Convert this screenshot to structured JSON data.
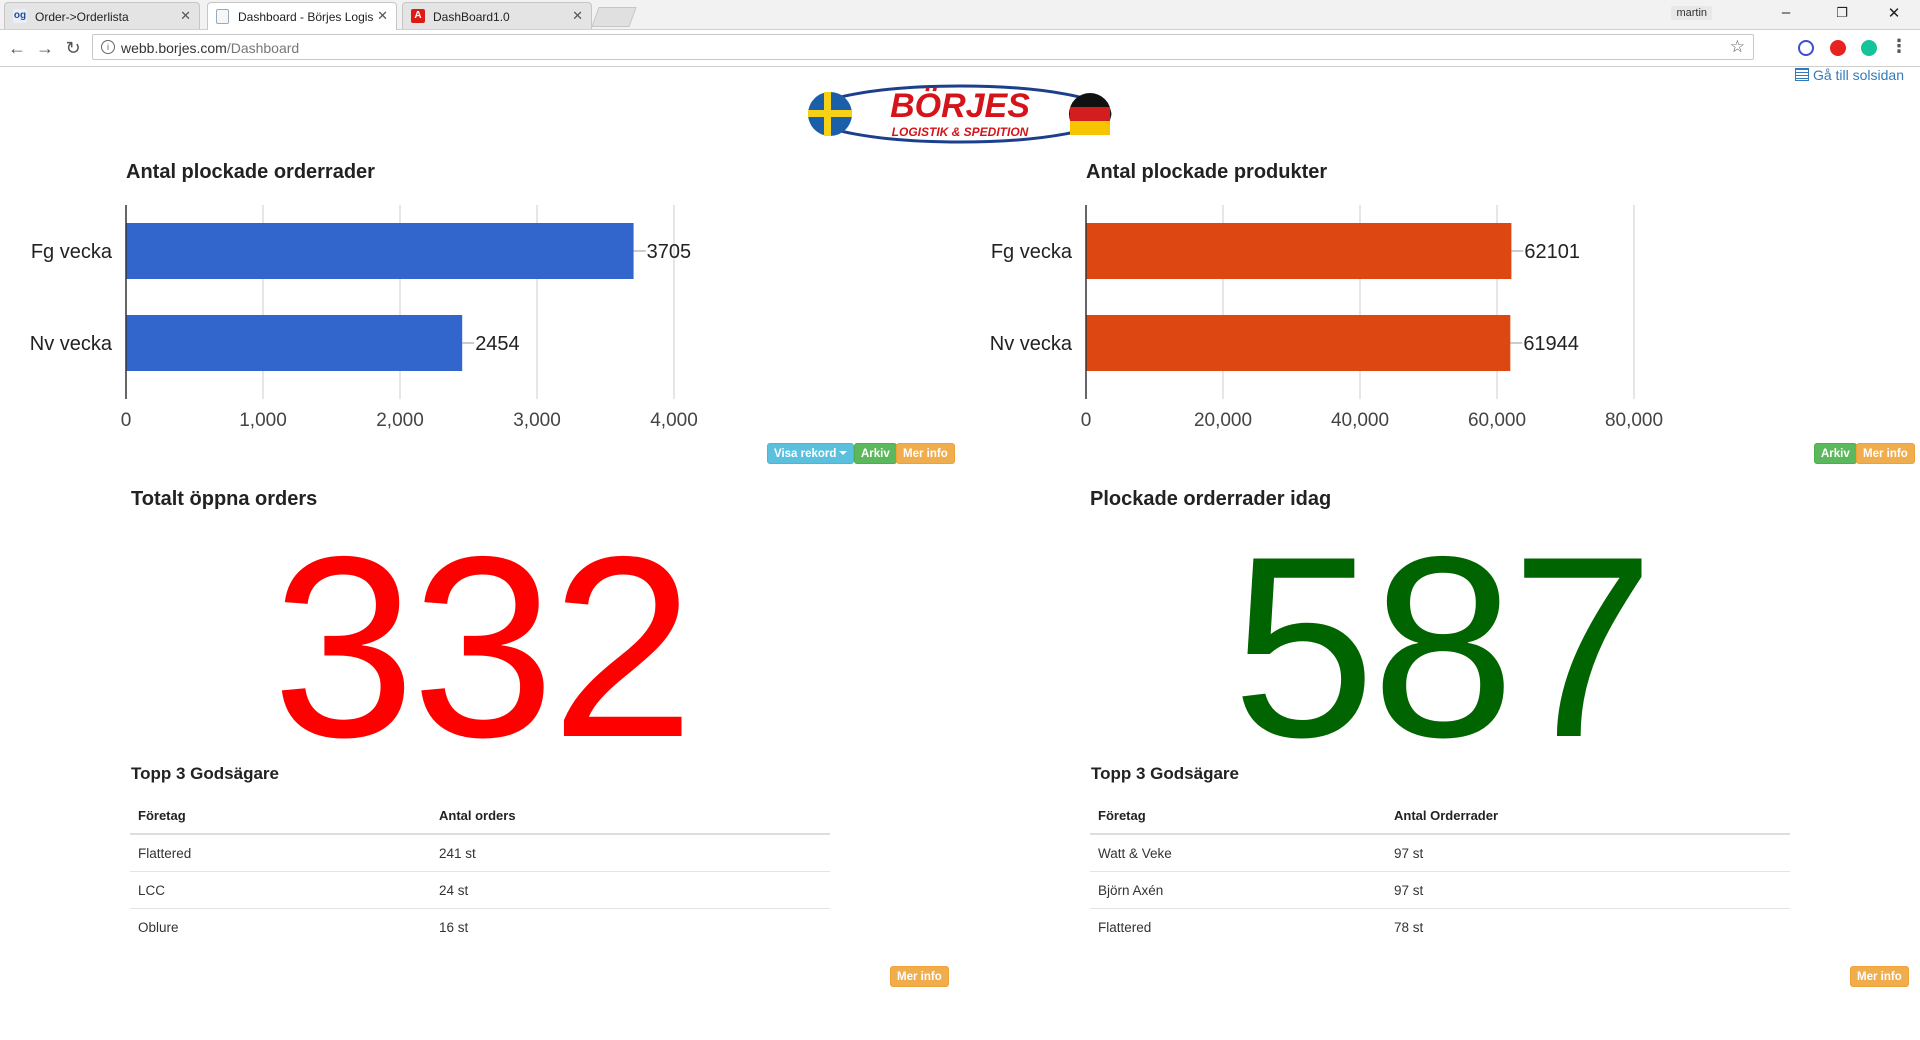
{
  "browser": {
    "tabs": [
      {
        "title": "Order->Orderlista",
        "favicon": "og",
        "active": false
      },
      {
        "title": "Dashboard - Börjes Logis",
        "favicon": "",
        "active": true
      },
      {
        "title": "DashBoard1.0",
        "favicon": "A",
        "active": false
      }
    ],
    "user": "martin",
    "url_host": "webb.borjes.com",
    "url_path": "/Dashboard"
  },
  "header": {
    "logo_text": "BÖRJES",
    "logo_subtitle": "LOGISTIK & SPEDITION",
    "home_link": "Gå till solsidan"
  },
  "left_chart": {
    "title": "Antal plockade orderrader",
    "buttons": {
      "record": "Visa rekord",
      "archive": "Arkiv",
      "more": "Mer info"
    },
    "chart_data": {
      "type": "bar",
      "orientation": "horizontal",
      "categories": [
        "Fg vecka",
        "Nv vecka"
      ],
      "values": [
        3705,
        2454
      ],
      "xlim": [
        0,
        4000
      ],
      "ticks": [
        "0",
        "1,000",
        "2,000",
        "3,000",
        "4,000"
      ],
      "color": "#3366cc",
      "grid": true
    }
  },
  "right_chart": {
    "title": "Antal plockade produkter",
    "buttons": {
      "archive": "Arkiv",
      "more": "Mer info"
    },
    "chart_data": {
      "type": "bar",
      "orientation": "horizontal",
      "categories": [
        "Fg vecka",
        "Nv vecka"
      ],
      "values": [
        62101,
        61944
      ],
      "xlim": [
        0,
        80000
      ],
      "ticks": [
        "0",
        "20,000",
        "40,000",
        "60,000",
        "80,000"
      ],
      "color": "#dc4712",
      "grid": true
    }
  },
  "open_orders": {
    "title": "Totalt öppna orders",
    "value": "332",
    "color": "#ff0000",
    "top_title": "Topp 3 Godsägare",
    "columns": [
      "Företag",
      "Antal orders"
    ],
    "rows": [
      [
        "Flattered",
        "241 st"
      ],
      [
        "LCC",
        "24 st"
      ],
      [
        "Oblure",
        "16 st"
      ]
    ],
    "more": "Mer info"
  },
  "picked_today": {
    "title": "Plockade orderrader idag",
    "value": "587",
    "color": "#006400",
    "top_title": "Topp 3 Godsägare",
    "columns": [
      "Företag",
      "Antal Orderrader"
    ],
    "rows": [
      [
        "Watt & Veke",
        "97 st"
      ],
      [
        "Björn Axén",
        "97 st"
      ],
      [
        "Flattered",
        "78 st"
      ]
    ],
    "more": "Mer info"
  }
}
